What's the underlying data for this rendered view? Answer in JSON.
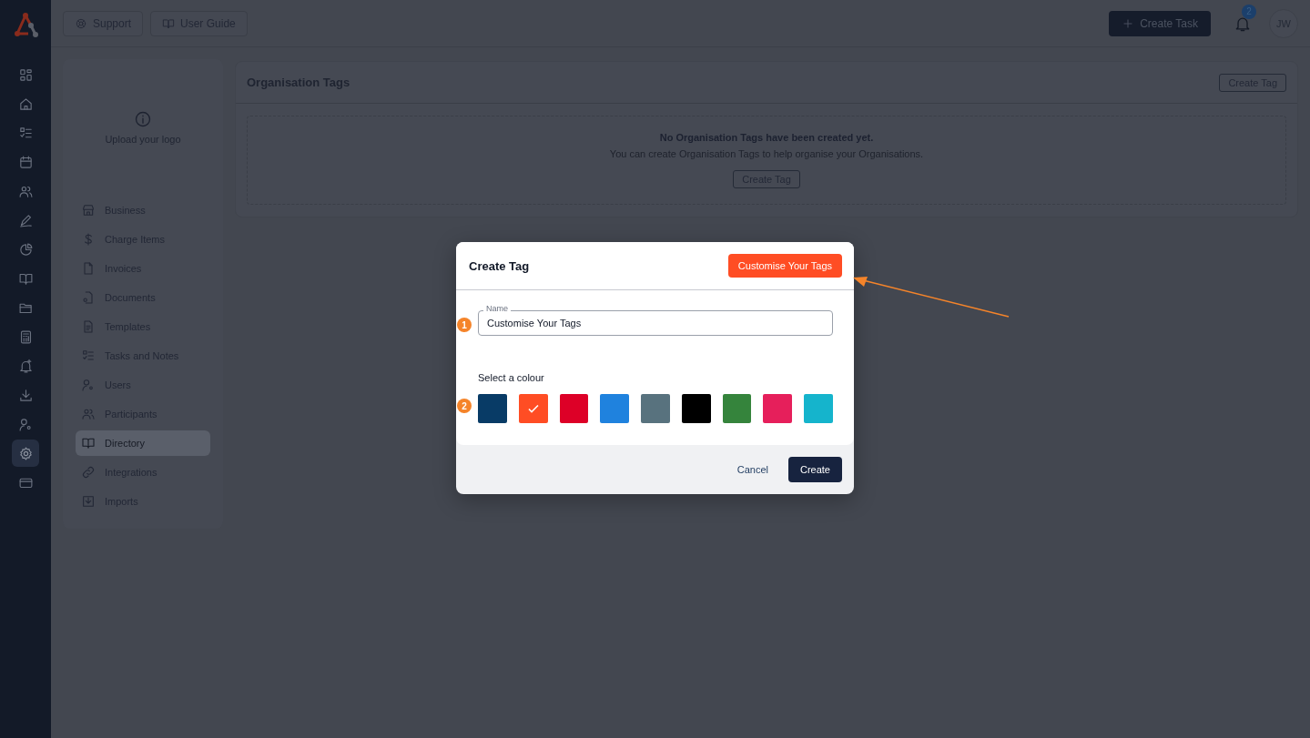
{
  "rail": {
    "items": [
      {
        "selected": false
      },
      {
        "selected": false
      },
      {
        "selected": false
      },
      {
        "selected": false
      },
      {
        "selected": false
      },
      {
        "selected": false
      },
      {
        "selected": false
      },
      {
        "selected": false
      },
      {
        "selected": false
      },
      {
        "selected": false
      },
      {
        "selected": false
      },
      {
        "selected": false
      },
      {
        "selected": false
      },
      {
        "selected": true
      },
      {
        "selected": false
      }
    ]
  },
  "topbar": {
    "buttons": [
      "Support",
      "User Guide"
    ],
    "create_task": "Create Task",
    "notification_count": "2",
    "avatar": "JW"
  },
  "settings_nav": {
    "logo_upload": "Upload your logo",
    "items": [
      {
        "label": "Business",
        "selected": false
      },
      {
        "label": "Charge Items",
        "selected": false
      },
      {
        "label": "Invoices",
        "selected": false
      },
      {
        "label": "Documents",
        "selected": false
      },
      {
        "label": "Templates",
        "selected": false
      },
      {
        "label": "Tasks and Notes",
        "selected": false
      },
      {
        "label": "Users",
        "selected": false
      },
      {
        "label": "Participants",
        "selected": false
      },
      {
        "label": "Directory",
        "selected": true
      },
      {
        "label": "Integrations",
        "selected": false
      },
      {
        "label": "Imports",
        "selected": false
      }
    ]
  },
  "tags_panel": {
    "title": "Organisation Tags",
    "header_button": "Create Tag",
    "empty_title": "No Organisation Tags have been created yet.",
    "empty_text": "You can create Organisation Tags to help organise your Organisations.",
    "empty_button": "Create Tag"
  },
  "dialog": {
    "title": "Create Tag",
    "header_button": "Customise Your Tags",
    "name_label": "Name",
    "name_value": "Customise Your Tags",
    "colour_label": "Select a colour",
    "colours": [
      {
        "color": "#083b66",
        "selected": false
      },
      {
        "color": "#ff4d24",
        "selected": true
      },
      {
        "color": "#dd0027",
        "selected": false
      },
      {
        "color": "#1f82de",
        "selected": false
      },
      {
        "color": "#58727e",
        "selected": false
      },
      {
        "color": "#000000",
        "selected": false
      },
      {
        "color": "#35843c",
        "selected": false
      },
      {
        "color": "#e61f5b",
        "selected": false
      },
      {
        "color": "#15b4cc",
        "selected": false
      }
    ],
    "cancel": "Cancel",
    "create": "Create"
  },
  "annotations": {
    "markers": [
      "1",
      "2"
    ]
  }
}
